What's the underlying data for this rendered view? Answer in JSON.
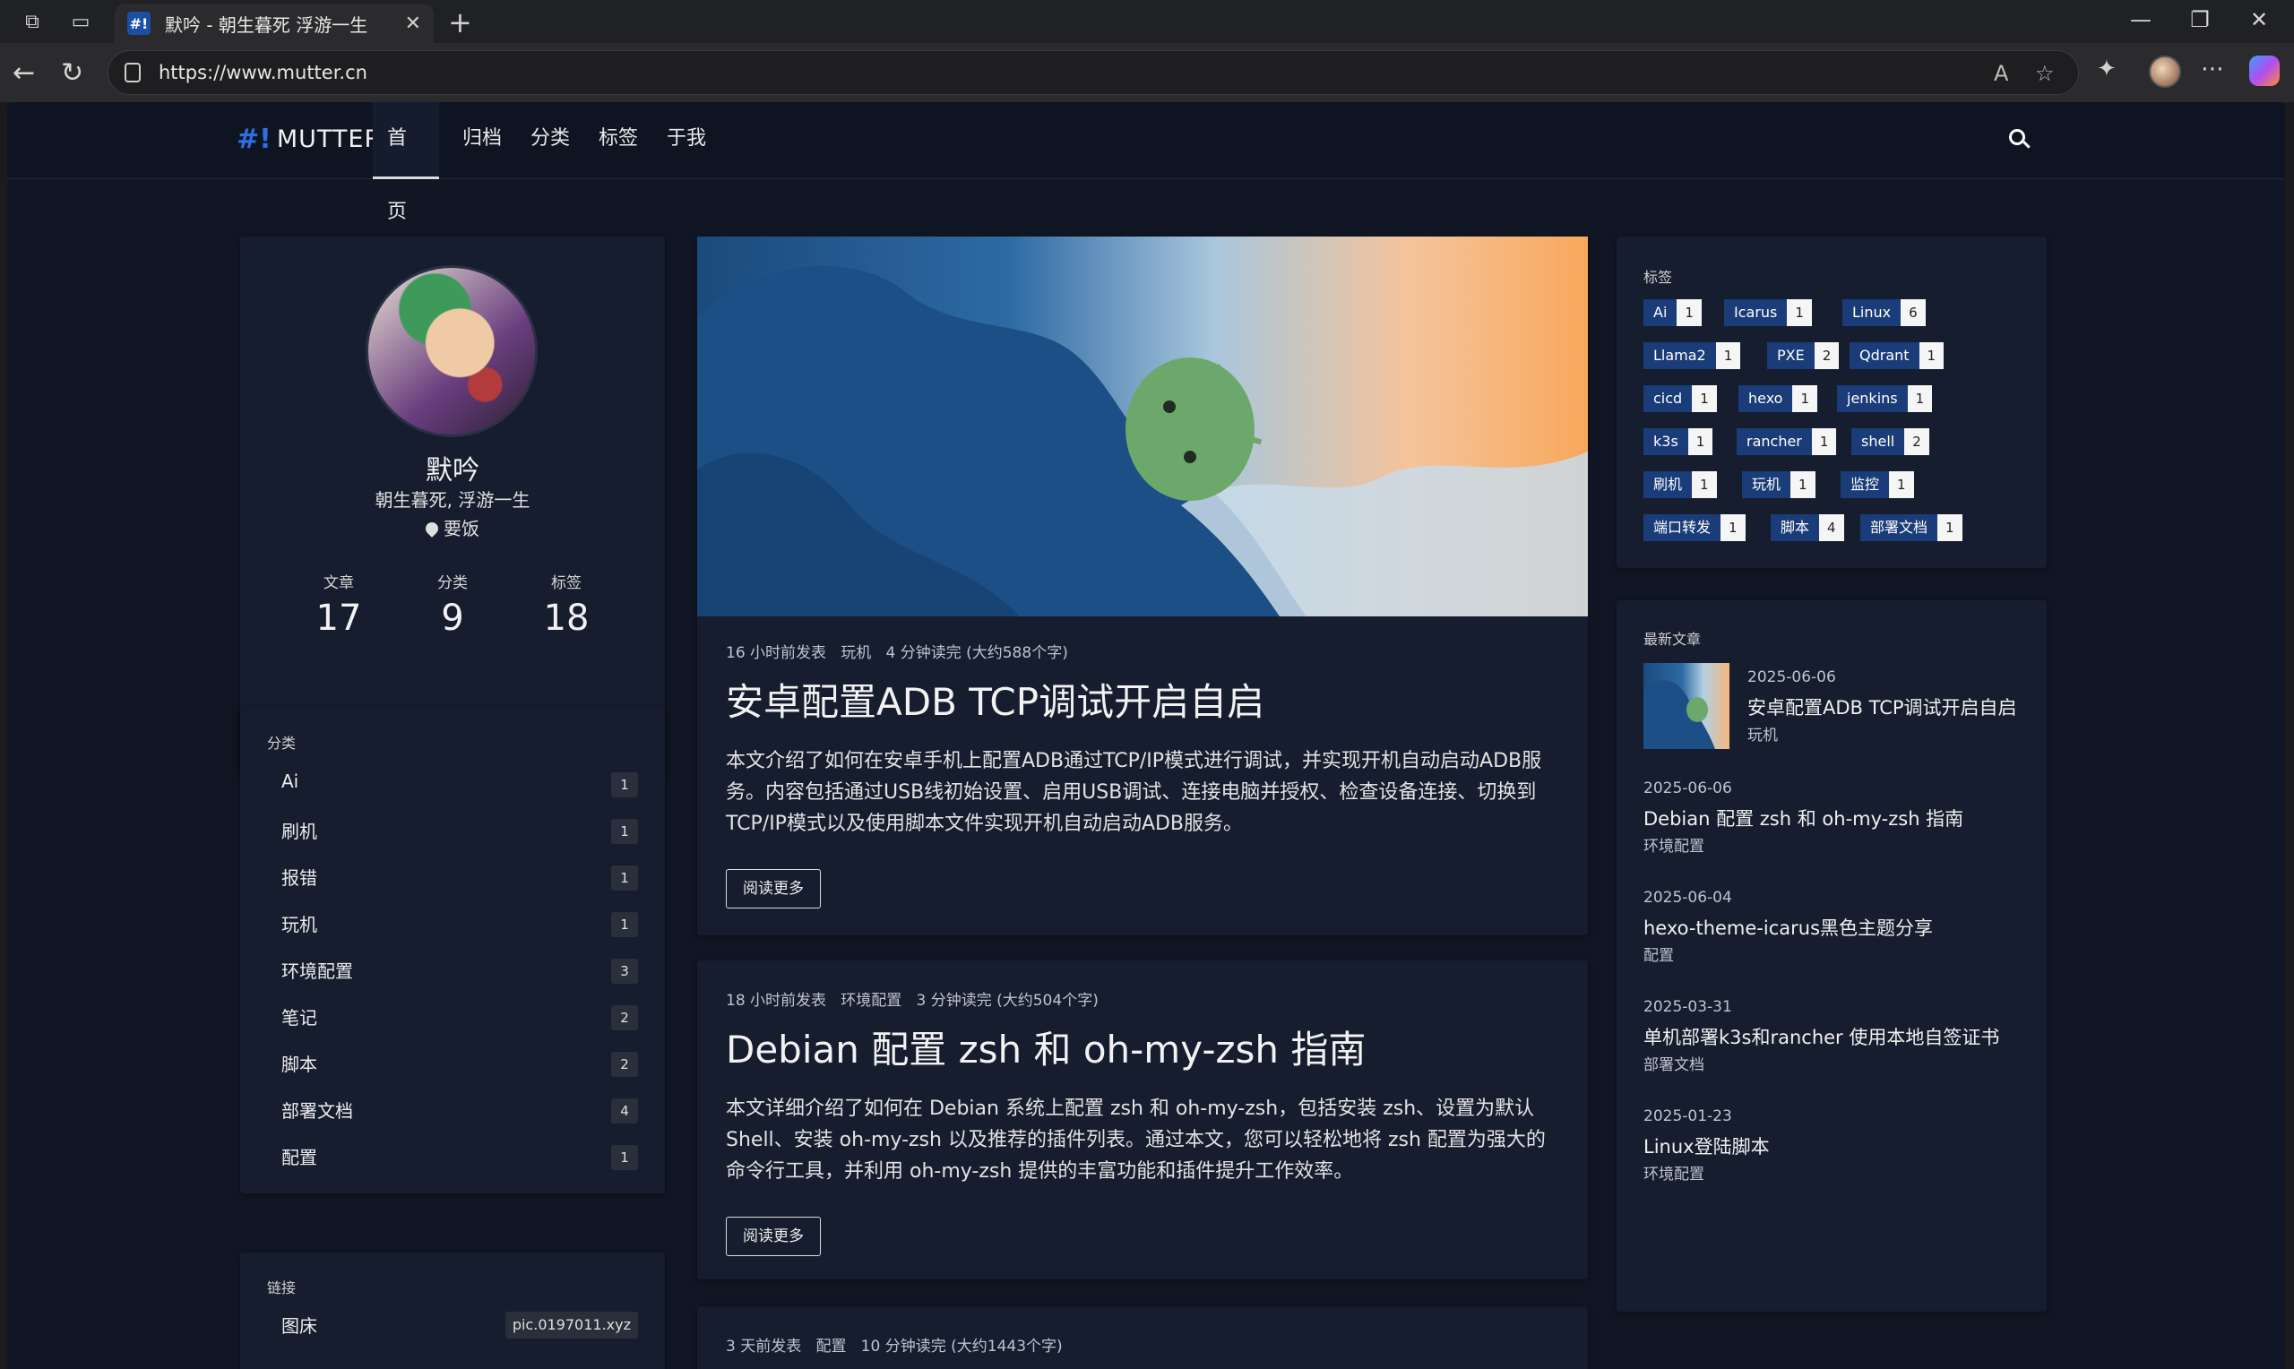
{
  "browser": {
    "tab_title": "默吟 - 朝生暮死 浮游一生",
    "tab_favicon_text": "#!",
    "url": "https://www.mutter.cn"
  },
  "site": {
    "logo_mark": "#!",
    "logo_text": "MUTTER",
    "nav": [
      {
        "label": "首页"
      },
      {
        "label": "归档"
      },
      {
        "label": "分类"
      },
      {
        "label": "标签"
      },
      {
        "label": "于我"
      }
    ]
  },
  "profile": {
    "name": "默吟",
    "motto": "朝生暮死, 浮游一生",
    "location": "要饭",
    "stats": [
      {
        "label": "文章",
        "value": "17"
      },
      {
        "label": "分类",
        "value": "9"
      },
      {
        "label": "标签",
        "value": "18"
      }
    ]
  },
  "categories": {
    "title": "分类",
    "items": [
      {
        "name": "Ai",
        "count": "1"
      },
      {
        "name": "刷机",
        "count": "1"
      },
      {
        "name": "报错",
        "count": "1"
      },
      {
        "name": "玩机",
        "count": "1"
      },
      {
        "name": "环境配置",
        "count": "3"
      },
      {
        "name": "笔记",
        "count": "2"
      },
      {
        "name": "脚本",
        "count": "2"
      },
      {
        "name": "部署文档",
        "count": "4"
      },
      {
        "name": "配置",
        "count": "1"
      }
    ]
  },
  "links": {
    "title": "链接",
    "items": [
      {
        "name": "图床",
        "url": "pic.0197011.xyz"
      }
    ]
  },
  "posts": [
    {
      "meta_time": "16 小时前发表",
      "meta_category": "玩机",
      "meta_read": "4 分钟读完 (大约588个字)",
      "title": "安卓配置ADB TCP调试开启自启",
      "excerpt": "本文介绍了如何在安卓手机上配置ADB通过TCP/IP模式进行调试，并实现开机自动启动ADB服务。内容包括通过USB线初始设置、启用USB调试、连接电脑并授权、检查设备连接、切换到TCP/IP模式以及使用脚本文件实现开机自动启动ADB服务。",
      "read_more": "阅读更多"
    },
    {
      "meta_time": "18 小时前发表",
      "meta_category": "环境配置",
      "meta_read": "3 分钟读完 (大约504个字)",
      "title": "Debian 配置 zsh 和 oh-my-zsh 指南",
      "excerpt": "本文详细介绍了如何在 Debian 系统上配置 zsh 和 oh-my-zsh，包括安装 zsh、设置为默认 Shell、安装 oh-my-zsh 以及推荐的插件列表。通过本文，您可以轻松地将 zsh 配置为强大的命令行工具，并利用 oh-my-zsh 提供的丰富功能和插件提升工作效率。",
      "read_more": "阅读更多"
    },
    {
      "meta_time": "3 天前发表",
      "meta_category": "配置",
      "meta_read": "10 分钟读完 (大约1443个字)"
    }
  ],
  "tags": {
    "title": "标签",
    "items": [
      {
        "name": "Ai",
        "count": "1"
      },
      {
        "name": "Icarus",
        "count": "1"
      },
      {
        "name": "Linux",
        "count": "6"
      },
      {
        "name": "Llama2",
        "count": "1"
      },
      {
        "name": "PXE",
        "count": "2"
      },
      {
        "name": "Qdrant",
        "count": "1"
      },
      {
        "name": "cicd",
        "count": "1"
      },
      {
        "name": "hexo",
        "count": "1"
      },
      {
        "name": "jenkins",
        "count": "1"
      },
      {
        "name": "k3s",
        "count": "1"
      },
      {
        "name": "rancher",
        "count": "1"
      },
      {
        "name": "shell",
        "count": "2"
      },
      {
        "name": "刷机",
        "count": "1"
      },
      {
        "name": "玩机",
        "count": "1"
      },
      {
        "name": "监控",
        "count": "1"
      },
      {
        "name": "端口转发",
        "count": "1"
      },
      {
        "name": "脚本",
        "count": "4"
      },
      {
        "name": "部署文档",
        "count": "1"
      }
    ]
  },
  "recent": {
    "title": "最新文章",
    "items": [
      {
        "date": "2025-06-06",
        "title": "安卓配置ADB TCP调试开启自启",
        "category": "玩机"
      },
      {
        "date": "2025-06-06",
        "title": "Debian 配置 zsh 和 oh-my-zsh 指南",
        "category": "环境配置"
      },
      {
        "date": "2025-06-04",
        "title": "hexo-theme-icarus黑色主题分享",
        "category": "配置"
      },
      {
        "date": "2025-03-31",
        "title": "单机部署k3s和rancher 使用本地自签证书",
        "category": "部署文档"
      },
      {
        "date": "2025-01-23",
        "title": "Linux登陆脚本",
        "category": "环境配置"
      }
    ]
  },
  "colors": {
    "page_bg": "#111625",
    "card_bg": "#161d2f",
    "tag_bg": "#1a3c78",
    "logo_accent": "#2e6fe0"
  }
}
